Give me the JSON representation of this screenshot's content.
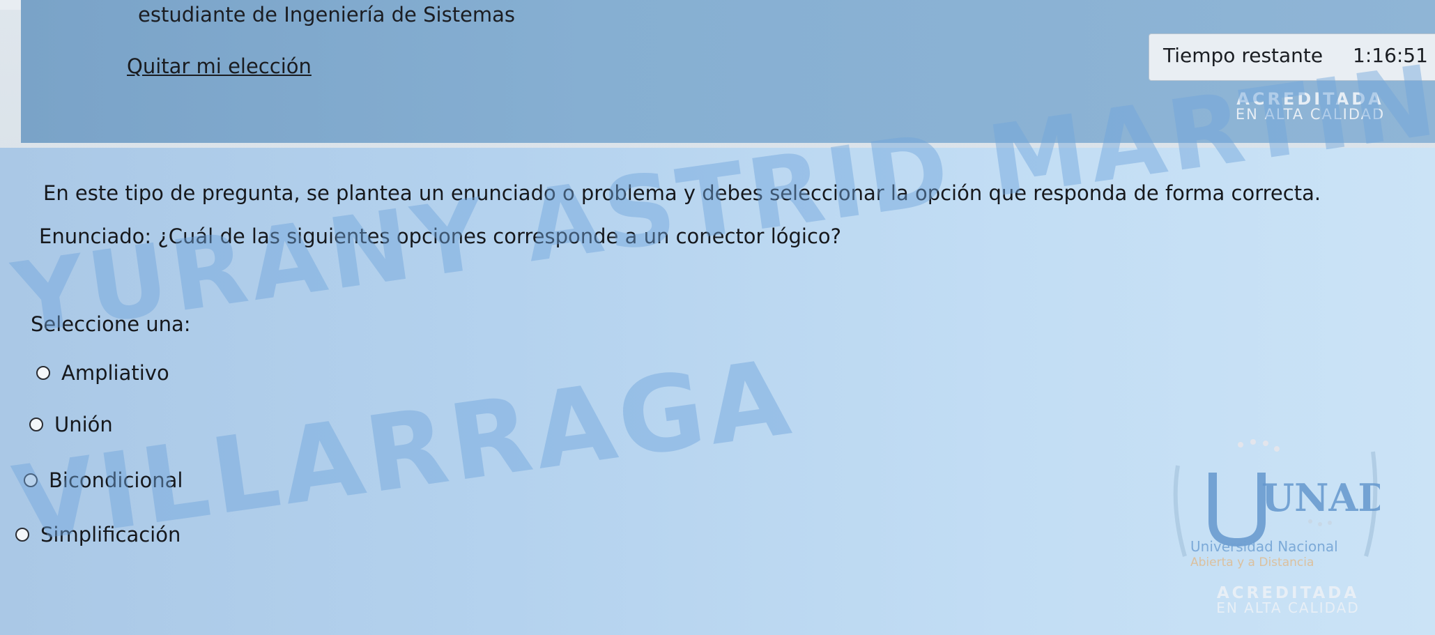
{
  "header": {
    "user_role": "estudiante de Ingeniería de Sistemas",
    "remove_choice_link": "Quitar mi elección",
    "timer_label": "Tiempo restante",
    "timer_value": "1:16:51",
    "accreditation_line1": "ACREDITADA",
    "accreditation_line2": "EN ALTA CALIDAD"
  },
  "question": {
    "instruction": "En este tipo de pregunta, se plantea un enunciado o problema y debes seleccionar la opción que responda de forma correcta.",
    "statement": "Enunciado: ¿Cuál de las siguientes opciones corresponde a un conector lógico?",
    "select_prompt": "Seleccione una:",
    "options": [
      {
        "label": "Ampliativo",
        "selected": false
      },
      {
        "label": "Unión",
        "selected": false
      },
      {
        "label": "Bicondicional",
        "selected": false
      },
      {
        "label": "Simplificación",
        "selected": false
      }
    ]
  },
  "watermark": {
    "line1": "YURANY ASTRID MARTINEZ",
    "line2": "VILLARRAGA"
  },
  "logo": {
    "name": "UNAD",
    "subtitle1": "Universidad Nacional",
    "subtitle2": "Abierta y a Distancia",
    "accreditation_line1": "ACREDITADA",
    "accreditation_line2": "EN ALTA CALIDAD"
  },
  "colors": {
    "header_bg": "#86afd2",
    "content_bg": "#b4d2ee",
    "text": "#16181c",
    "watermark": "#6ea5dc"
  }
}
